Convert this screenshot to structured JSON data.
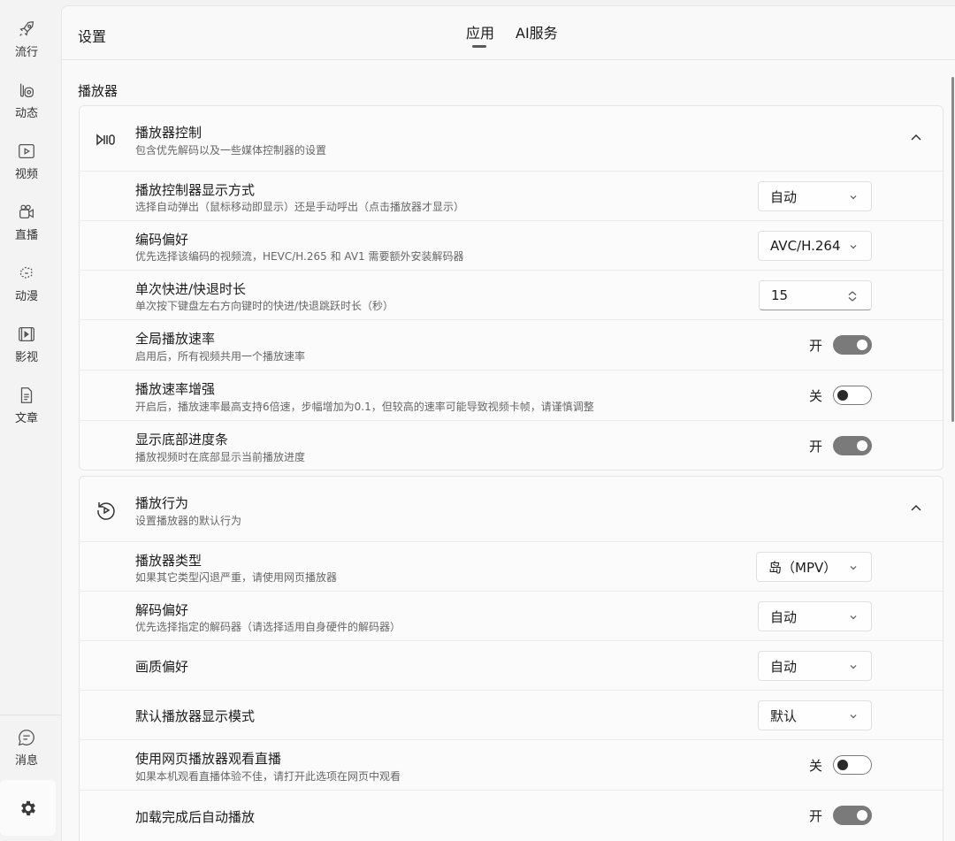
{
  "sidebar": {
    "items": [
      {
        "label": "流行",
        "icon": "rocket-icon"
      },
      {
        "label": "动态",
        "icon": "feed-icon"
      },
      {
        "label": "视频",
        "icon": "video-play-icon"
      },
      {
        "label": "直播",
        "icon": "live-icon"
      },
      {
        "label": "动漫",
        "icon": "anime-icon"
      },
      {
        "label": "影视",
        "icon": "film-icon"
      },
      {
        "label": "文章",
        "icon": "article-icon"
      }
    ],
    "messages": {
      "label": "消息",
      "icon": "chat-icon"
    },
    "settings": {
      "icon": "gear-icon"
    }
  },
  "header": {
    "title": "设置",
    "tabs": [
      {
        "label": "应用",
        "active": true
      },
      {
        "label": "AI服务",
        "active": false
      }
    ]
  },
  "section": {
    "title": "播放器"
  },
  "cards": [
    {
      "title": "播放器控制",
      "desc": "包含优先解码以及一些媒体控制器的设置",
      "icon": "playback-controls-icon",
      "rows": [
        {
          "title": "播放控制器显示方式",
          "desc": "选择自动弹出（鼠标移动即显示）还是手动呼出（点击播放器才显示）",
          "control": "dropdown",
          "value": "自动"
        },
        {
          "title": "编码偏好",
          "desc": "优先选择该编码的视频流，HEVC/H.265 和 AV1 需要额外安装解码器",
          "control": "dropdown",
          "value": "AVC/H.264"
        },
        {
          "title": "单次快进/快退时长",
          "desc": "单次按下键盘左右方向键时的快进/快退跳跃时长（秒）",
          "control": "number",
          "value": "15"
        },
        {
          "title": "全局播放速率",
          "desc": "启用后，所有视频共用一个播放速率",
          "control": "toggle",
          "state": "开",
          "on": true
        },
        {
          "title": "播放速率增强",
          "desc": "开启后，播放速率最高支持6倍速，步幅增加为0.1，但较高的速率可能导致视频卡帧，请谨慎调整",
          "control": "toggle",
          "state": "关",
          "on": false
        },
        {
          "title": "显示底部进度条",
          "desc": "播放视频时在底部显示当前播放进度",
          "control": "toggle",
          "state": "开",
          "on": true
        }
      ]
    },
    {
      "title": "播放行为",
      "desc": "设置播放器的默认行为",
      "icon": "replay-icon",
      "rows": [
        {
          "title": "播放器类型",
          "desc": "如果其它类型闪退严重，请使用网页播放器",
          "control": "dropdown",
          "value": "岛（MPV）"
        },
        {
          "title": "解码偏好",
          "desc": "优先选择指定的解码器（请选择适用自身硬件的解码器）",
          "control": "dropdown",
          "value": "自动"
        },
        {
          "title": "画质偏好",
          "desc": "",
          "control": "dropdown",
          "value": "自动"
        },
        {
          "title": "默认播放器显示模式",
          "desc": "",
          "control": "dropdown",
          "value": "默认"
        },
        {
          "title": "使用网页播放器观看直播",
          "desc": "如果本机观看直播体验不佳，请打开此选项在网页中观看",
          "control": "toggle",
          "state": "关",
          "on": false
        },
        {
          "title": "加载完成后自动播放",
          "desc": "",
          "control": "toggle",
          "state": "开",
          "on": true
        }
      ]
    }
  ]
}
